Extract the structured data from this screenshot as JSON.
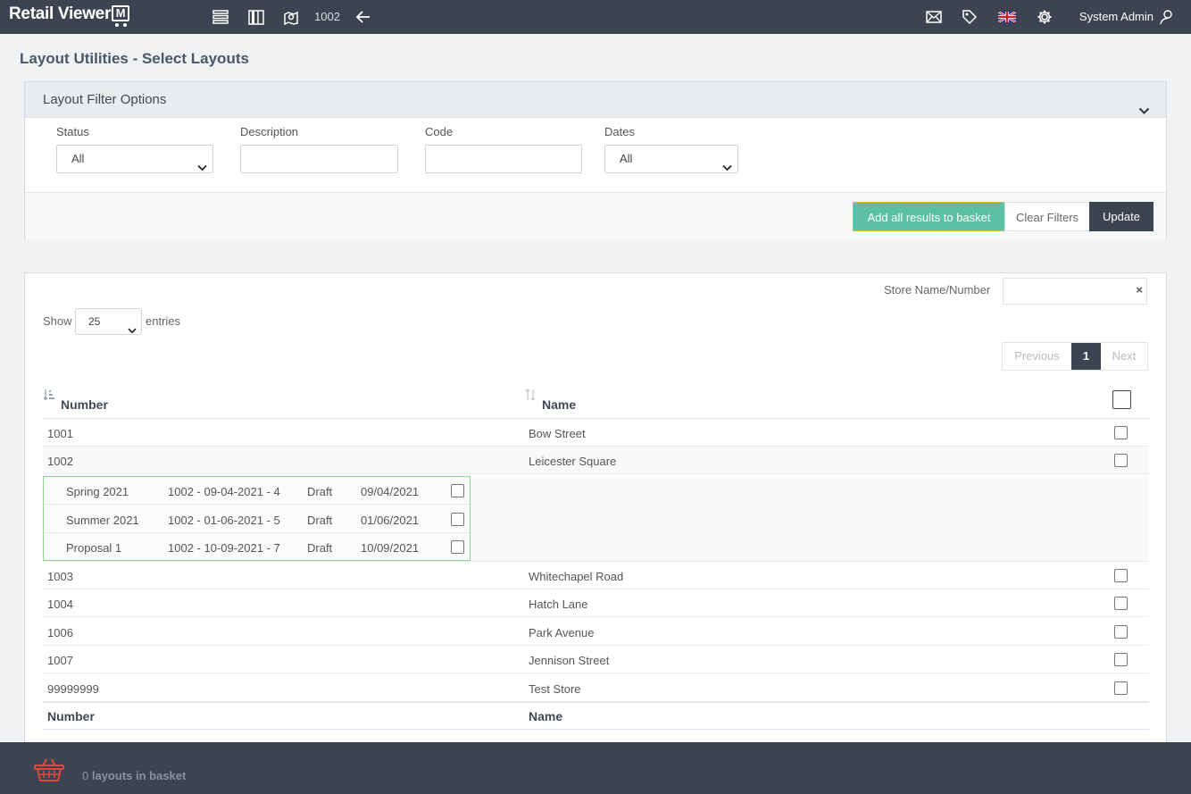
{
  "app": {
    "logo_text": "Retail Viewer",
    "logo_badge": "M",
    "store_number": "1002",
    "user_name": "System Admin"
  },
  "page": {
    "title": "Layout Utilities - Select Layouts"
  },
  "filters": {
    "panel_title": "Layout Filter Options",
    "status_label": "Status",
    "status_value": "All",
    "description_label": "Description",
    "description_value": "",
    "code_label": "Code",
    "code_value": "",
    "dates_label": "Dates",
    "dates_value": "All",
    "add_all_label": "Add all results to basket",
    "clear_label": "Clear Filters",
    "update_label": "Update"
  },
  "results": {
    "search_label": "Store Name/Number",
    "search_value": "",
    "search_clear": "×",
    "show_label": "Show",
    "page_length": "25",
    "entries_label": "entries",
    "pager": {
      "previous": "Previous",
      "current": "1",
      "next": "Next"
    },
    "columns": {
      "number": "Number",
      "name": "Name"
    },
    "rows": [
      {
        "number": "1001",
        "name": "Bow Street"
      },
      {
        "number": "1002",
        "name": "Leicester Square"
      },
      {
        "number": "1003",
        "name": "Whitechapel Road"
      },
      {
        "number": "1004",
        "name": "Hatch Lane"
      },
      {
        "number": "1006",
        "name": "Park Avenue"
      },
      {
        "number": "1007",
        "name": "Jennison Street"
      },
      {
        "number": "99999999",
        "name": "Test Store"
      }
    ],
    "layouts_1002": [
      {
        "name": "Spring 2021",
        "code": "1002 - 09-04-2021 - 4",
        "status": "Draft",
        "date": "09/04/2021"
      },
      {
        "name": "Summer 2021",
        "code": "1002 - 01-06-2021 - 5",
        "status": "Draft",
        "date": "01/06/2021"
      },
      {
        "name": "Proposal 1",
        "code": "1002 - 10-09-2021 - 7",
        "status": "Draft",
        "date": "10/09/2021"
      }
    ]
  },
  "basket": {
    "count": "0",
    "label": "layouts in basket"
  },
  "colors": {
    "topbar": "#3b4450",
    "accent_green": "#5cc0a2",
    "basket_red": "#e0463a"
  }
}
